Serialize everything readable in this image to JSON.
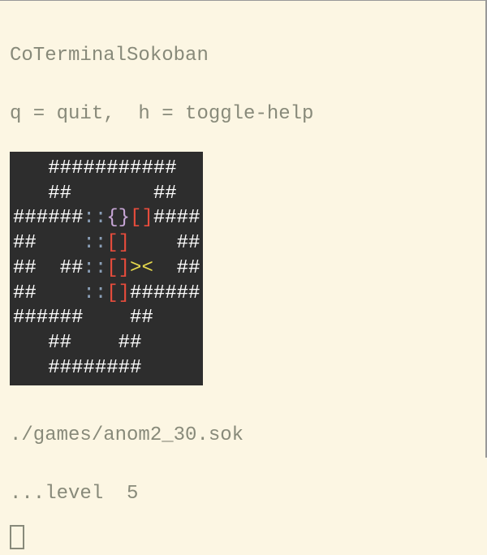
{
  "header": {
    "title": "CoTerminalSokoban",
    "help": "q = quit,  h = toggle-help"
  },
  "game": {
    "rows": [
      [
        {
          "t": "   ",
          "c": "wall"
        },
        {
          "t": "###########",
          "c": "wall"
        }
      ],
      [
        {
          "t": "   ",
          "c": "wall"
        },
        {
          "t": "##       ##",
          "c": "wall"
        }
      ],
      [
        {
          "t": "######",
          "c": "wall"
        },
        {
          "t": "::",
          "c": "goal"
        },
        {
          "t": "{}",
          "c": "box-on-goal"
        },
        {
          "t": "[]",
          "c": "box"
        },
        {
          "t": "####",
          "c": "wall"
        }
      ],
      [
        {
          "t": "##   ",
          "c": "wall"
        },
        {
          "t": " ::",
          "c": "goal"
        },
        {
          "t": "[]",
          "c": "box"
        },
        {
          "t": "    ##",
          "c": "wall"
        }
      ],
      [
        {
          "t": "##  ##",
          "c": "wall"
        },
        {
          "t": "::",
          "c": "goal"
        },
        {
          "t": "[]",
          "c": "box"
        },
        {
          "t": "><",
          "c": "player"
        },
        {
          "t": "  ##",
          "c": "wall"
        }
      ],
      [
        {
          "t": "##   ",
          "c": "wall"
        },
        {
          "t": " ::",
          "c": "goal"
        },
        {
          "t": "[]",
          "c": "box"
        },
        {
          "t": "######",
          "c": "wall"
        }
      ],
      [
        {
          "t": "######",
          "c": "wall"
        },
        {
          "t": "    ##",
          "c": "wall"
        }
      ],
      [
        {
          "t": "   ##    ##",
          "c": "wall"
        }
      ],
      [
        {
          "t": "   ########",
          "c": "wall"
        }
      ]
    ]
  },
  "footer": {
    "path": "./games/anom2_30.sok",
    "level": "...level  5"
  }
}
